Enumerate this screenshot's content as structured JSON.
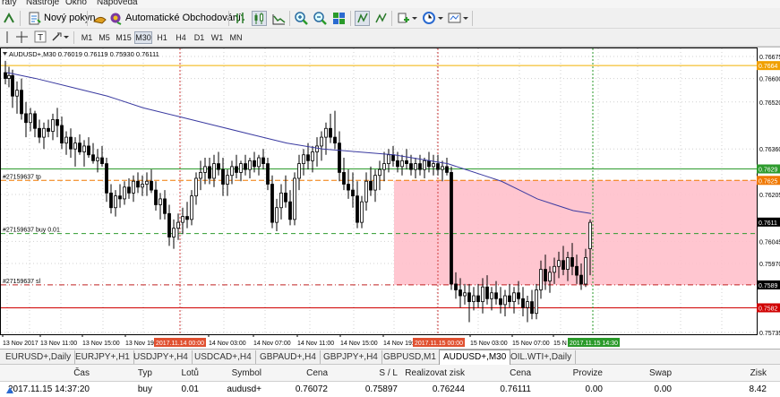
{
  "menu": {
    "items": [
      "rafy",
      "Nástroje",
      "Okno",
      "Nápověda"
    ]
  },
  "toolbar": {
    "new_order_label": "Nový pokyn",
    "autotrading_label": "Automatické Obchodování"
  },
  "timeframes": [
    "M1",
    "M5",
    "M15",
    "M30",
    "H1",
    "H4",
    "D1",
    "W1",
    "MN"
  ],
  "active_timeframe": "M30",
  "chart": {
    "header": "AUDUSD+,M30  0.76019 0.76119 0.75930 0.76111",
    "price_labels": [
      "0.76675",
      "0.76600",
      "0.76520",
      "0.76360",
      "0.76205",
      "0.76045",
      "0.75970",
      "0.75735"
    ],
    "price_levels": [
      0.76675,
      0.766,
      0.7652,
      0.7636,
      0.76205,
      0.76045,
      0.7597,
      0.75735
    ],
    "highlight_labels": [
      {
        "text": "0.7664",
        "price": 0.76644,
        "color": "#f0a000"
      },
      {
        "text": "0.7629",
        "price": 0.76292,
        "color": "#2e9b2e"
      },
      {
        "text": "0.7625",
        "price": 0.76253,
        "color": "#f07800"
      },
      {
        "text": "0.7611",
        "price": 0.76111,
        "color": "#000000"
      },
      {
        "text": "0.7589",
        "price": 0.75897,
        "color": "#000000"
      },
      {
        "text": "0.7582",
        "price": 0.75819,
        "color": "#d00000"
      }
    ],
    "order_labels": {
      "tp": "#27159637 tp",
      "buy": "#27159637 buy 0.01",
      "sl": "#27159637 sl"
    },
    "time_labels": [
      "13 Nov 2017",
      "13 Nov 11:00",
      "13 Nov 15:00",
      "13 Nov 19:00",
      "14 Nov 03:00",
      "14 Nov 07:00",
      "14 Nov 11:00",
      "14 Nov 15:00",
      "14 Nov 19:00",
      "15 Nov 03:00",
      "15 Nov 07:00",
      "15 N"
    ],
    "marker_labels": [
      "2017.11.14 00:00",
      "2017.11.15 00:00",
      "2017.11.15 14:30"
    ],
    "colors": {
      "candle": "#000000",
      "ma": "#3a3aa0",
      "zone": "#ffc0cb",
      "grid": "#d0d0d0",
      "sl_line": "#d00000",
      "tp_line": "#f07800",
      "buy_line": "#2e9b2e"
    }
  },
  "tabs": [
    "EURUSD+,Daily",
    "EURJPY+,H1",
    "USDJPY+,H4",
    "USDCAD+,H4",
    "GBPAUD+,H4",
    "GBPJPY+,H4",
    "GBPUSD,M1",
    "AUDUSD+,M30",
    "OIL.WTI+,Daily"
  ],
  "active_tab": "AUDUSD+,M30",
  "trade_table": {
    "headers": [
      "Čas",
      "Typ",
      "Lotů",
      "Symbol",
      "Cena",
      "S / L",
      "Realizovat zisk",
      "Cena",
      "Provize",
      "Swap",
      "Zisk"
    ],
    "row": [
      "2017.11.15 14:37:20",
      "buy",
      "0.01",
      "audusd+",
      "0.76072",
      "0.75897",
      "0.76244",
      "0.76111",
      "0.00",
      "0.00",
      "8.42"
    ]
  }
}
